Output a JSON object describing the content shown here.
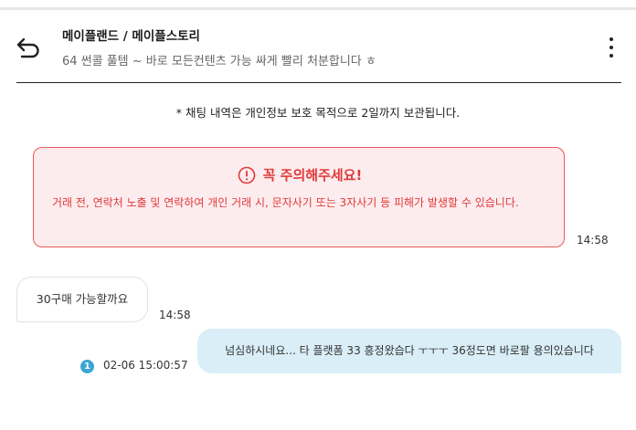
{
  "header": {
    "title": "메이플랜드 / 메이플스토리",
    "subtitle": "64 썬콜 풀템 ~ 바로 모든컨텐츠 가능 싸게 빨리 처분합니다 ㅎ",
    "back_icon": "back-arrow-icon",
    "menu_icon": "more-vertical-icon"
  },
  "notice": "* 채팅 내역은 개인정보 보호 목적으로 2일까지 보관됩니다.",
  "warning": {
    "title": "꼭 주의해주세요!",
    "body": "거래 전, 연락처 노출 및 연락하여 개인 거래 시, 문자사기 또는 3자사기 등 피해가 발생할 수 있습니다.",
    "time": "14:58",
    "icon": "alert-circle-icon",
    "color": "#e03a3a",
    "background": "#fdecee"
  },
  "messages": [
    {
      "direction": "incoming",
      "text": "30구매 가능할까요",
      "time": "14:58"
    },
    {
      "direction": "outgoing",
      "text": "넘심하시네요... 타 플랫폼 33 흥정왔습다 ㅜㅜㅜ 36정도면 바로팔 용의있습니다",
      "time": "02-06 15:00:57",
      "unread": "1",
      "bubble_color": "#d9eef7",
      "badge_color": "#3aa5d3"
    }
  ]
}
